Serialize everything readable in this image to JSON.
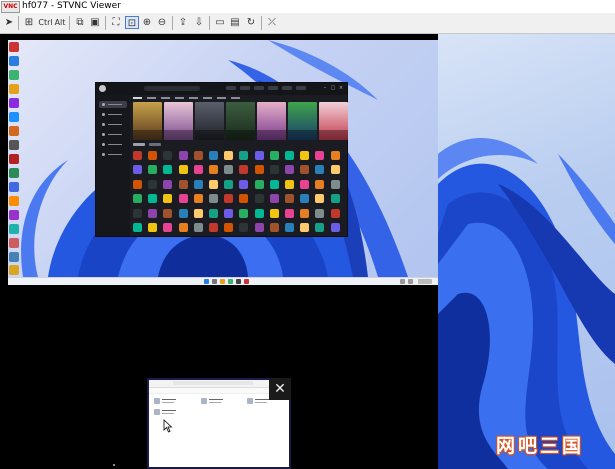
{
  "window": {
    "title": "hf077 - STVNC Viewer",
    "app_icon": "vnc-logo-icon",
    "app_icon_text": "VNC"
  },
  "toolbar": {
    "items": [
      {
        "name": "send-icon",
        "glyph": "➤"
      },
      {
        "name": "ctrl-alt-del-icon",
        "glyph": "⊞"
      },
      {
        "name": "ctrl-key",
        "label": "Ctrl"
      },
      {
        "name": "alt-key",
        "label": "Alt"
      },
      {
        "name": "copy-icon",
        "glyph": "⧉"
      },
      {
        "name": "screenshot-icon",
        "glyph": "▣"
      },
      {
        "name": "fullscreen-icon",
        "glyph": "⛶"
      },
      {
        "name": "fit-window-icon",
        "glyph": "⊡",
        "selected": true
      },
      {
        "name": "zoom-in-icon",
        "glyph": "⊕"
      },
      {
        "name": "zoom-out-icon",
        "glyph": "⊖"
      },
      {
        "name": "upload-icon",
        "glyph": "⇪"
      },
      {
        "name": "download-icon",
        "glyph": "⇩"
      },
      {
        "name": "chat-icon",
        "glyph": "▭"
      },
      {
        "name": "file-transfer-icon",
        "glyph": "▤"
      },
      {
        "name": "refresh-icon",
        "glyph": "↻"
      },
      {
        "name": "disconnect-icon",
        "glyph": "⤫"
      }
    ]
  },
  "explorer_popup": {
    "close_glyph": "✕"
  },
  "watermark": {
    "text": "网吧三国"
  },
  "colors": {
    "wallpaper_blue": "#1e4fd8",
    "toolbar_bg": "#f0f0f0",
    "game_app_bg": "#1b1c22",
    "watermark_stroke": "#d9531e"
  }
}
